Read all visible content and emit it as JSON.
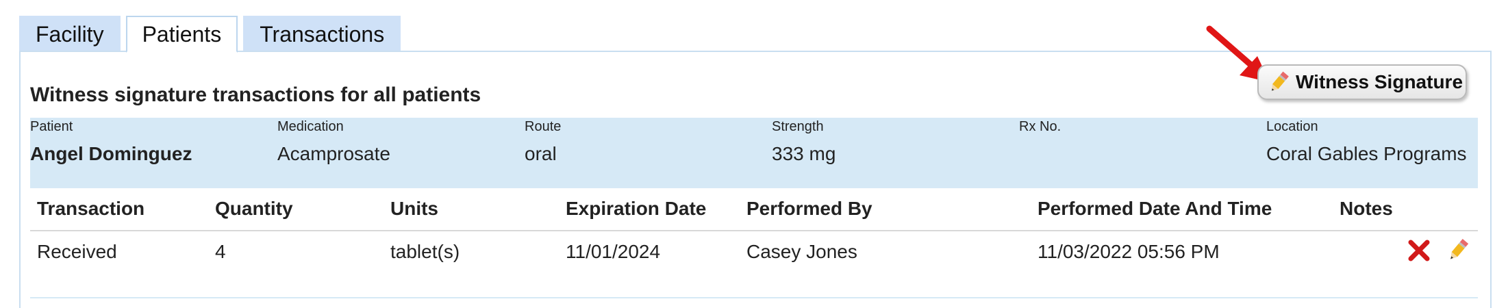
{
  "tabs": [
    {
      "label": "Facility",
      "active": false
    },
    {
      "label": "Patients",
      "active": true
    },
    {
      "label": "Transactions",
      "active": false
    }
  ],
  "page": {
    "title": "Witness signature transactions for all patients",
    "witness_button_label": "Witness Signature"
  },
  "patient_info": {
    "patient_label": "Patient",
    "patient_value": "Angel Dominguez",
    "medication_label": "Medication",
    "medication_value": "Acamprosate",
    "route_label": "Route",
    "route_value": "oral",
    "strength_label": "Strength",
    "strength_value": "333 mg",
    "rx_label": "Rx No.",
    "rx_value": "",
    "location_label": "Location",
    "location_value": "Coral Gables Programs"
  },
  "table": {
    "headers": [
      "Transaction",
      "Quantity",
      "Units",
      "Expiration Date",
      "Performed By",
      "Performed Date And Time",
      "Notes"
    ],
    "rows": [
      {
        "transaction": "Received",
        "quantity": "4",
        "units": "tablet(s)",
        "expiration_date": "11/01/2024",
        "performed_by": "Casey Jones",
        "performed_datetime": "11/03/2022 05:56 PM",
        "notes": ""
      }
    ]
  },
  "icons": {
    "pencil": "pencil-icon",
    "delete": "red-x-icon",
    "annotation": "red-arrow"
  },
  "colors": {
    "tab_bg": "#cfe1f7",
    "info_band_bg": "#d6e9f6",
    "panel_border": "#c9def0",
    "delete_red": "#d11a1a",
    "annotation_red": "#e01616"
  }
}
